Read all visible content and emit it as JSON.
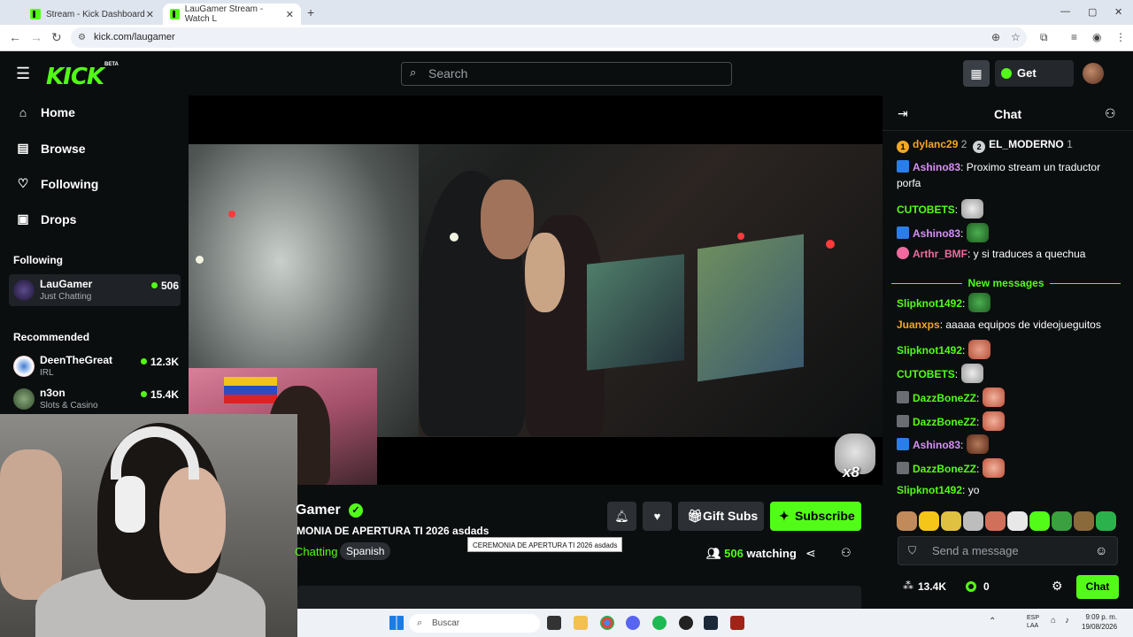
{
  "browser": {
    "tabs": [
      {
        "title": "Stream - Kick Dashboard"
      },
      {
        "title": "LauGamer Stream - Watch L"
      }
    ],
    "url": "kick.com/laugamer"
  },
  "header": {
    "logo": "KICK",
    "beta": "BETA",
    "search_placeholder": "Search",
    "get_kicks": "Get KICKs"
  },
  "sidebar": {
    "nav": [
      {
        "label": "Home",
        "icon": "home-icon"
      },
      {
        "label": "Browse",
        "icon": "browse-icon"
      },
      {
        "label": "Following",
        "icon": "heart-icon"
      },
      {
        "label": "Drops",
        "icon": "drops-icon"
      }
    ],
    "following_title": "Following",
    "following": [
      {
        "name": "LauGamer",
        "category": "Just Chatting",
        "viewers": "506"
      }
    ],
    "recommended_title": "Recommended",
    "recommended": [
      {
        "name": "DeenTheGreat",
        "category": "IRL",
        "viewers": "12.3K"
      },
      {
        "name": "n3on",
        "category": "Slots & Casino",
        "viewers": "15.4K"
      }
    ]
  },
  "player": {
    "emote_count": "x8"
  },
  "stream": {
    "name": "Gamer",
    "title": "MONIA DE APERTURA TI 2026 asdads",
    "category": "Chatting",
    "language": "Spanish",
    "gift_subs": "Gift Subs",
    "subscribe": "Subscribe",
    "watching_count": "506",
    "watching_label": "watching",
    "tooltip": "CEREMONIA DE APERTURA TI 2026 asdads"
  },
  "chat": {
    "title": "Chat",
    "pinned": [
      {
        "rank": "1",
        "user": "dylanc29",
        "count": "2"
      },
      {
        "rank": "2",
        "user": "EL_MODERNO",
        "count": "1"
      }
    ],
    "messages": [
      {
        "user": "Ashino83",
        "text": "Proximo stream un traductor porfa",
        "color": "#d790f7"
      },
      {
        "user": "CUTOBETS",
        "text": "",
        "color": "#53fc18"
      },
      {
        "user": "Ashino83",
        "text": "",
        "color": "#d790f7"
      },
      {
        "user": "Arthr_BMF",
        "text": "y si traduces a quechua",
        "color": "#f06aa0"
      }
    ],
    "new_messages": "New messages",
    "messages2": [
      {
        "user": "Slipknot1492",
        "text": "",
        "color": "#53fc18"
      },
      {
        "user": "Juanxps",
        "text": "aaaaa equipos de videojueguitos",
        "color": "#f5a623"
      },
      {
        "user": "Slipknot1492",
        "text": "",
        "color": "#53fc18"
      },
      {
        "user": "CUTOBETS",
        "text": "",
        "color": "#53fc18"
      },
      {
        "user": "DazzBoneZZ",
        "text": "",
        "color": "#53fc18"
      },
      {
        "user": "DazzBoneZZ",
        "text": "",
        "color": "#53fc18"
      },
      {
        "user": "Ashino83",
        "text": "",
        "color": "#d790f7"
      },
      {
        "user": "DazzBoneZZ",
        "text": "",
        "color": "#53fc18"
      },
      {
        "user": "Slipknot1492",
        "text": "yo",
        "color": "#53fc18"
      }
    ],
    "input_placeholder": "Send a message",
    "kicks": "13.4K",
    "points": "0",
    "send": "Chat"
  },
  "taskbar": {
    "search": "Buscar",
    "lang": "ESP",
    "lang2": "LAA",
    "time": "9:09 p. m.",
    "date": "19/08/2026"
  },
  "colors": {
    "accent": "#53fc18",
    "bg": "#0b0e0f",
    "panel": "#2c3035"
  }
}
